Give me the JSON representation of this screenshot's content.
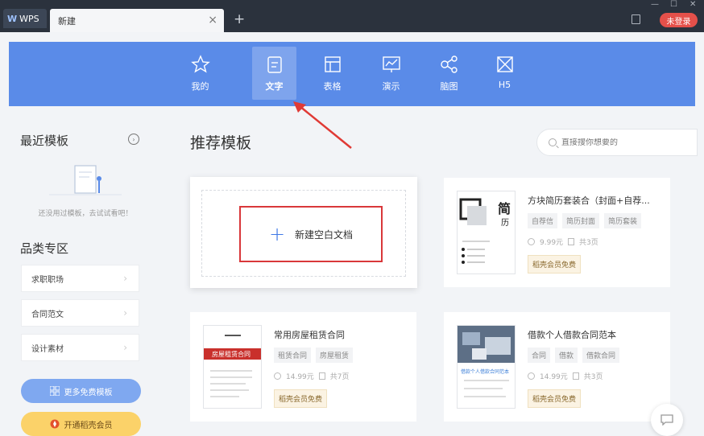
{
  "titlebar": {
    "logo": "WPS",
    "tab_label": "新建",
    "login_label": "未登录",
    "win_min": "—",
    "win_max": "☐",
    "win_close": "✕"
  },
  "nav": {
    "items": [
      {
        "label": "我的",
        "icon": "star-icon"
      },
      {
        "label": "文字",
        "icon": "document-icon"
      },
      {
        "label": "表格",
        "icon": "table-icon"
      },
      {
        "label": "演示",
        "icon": "presentation-icon"
      },
      {
        "label": "脑图",
        "icon": "mindmap-icon"
      },
      {
        "label": "H5",
        "icon": "h5-icon"
      }
    ],
    "active": "文字"
  },
  "sidebar": {
    "recent_title": "最近模板",
    "empty_text": "还没用过模板，去试试看吧！",
    "category_title": "品类专区",
    "categories": [
      "求职职场",
      "合同范文",
      "设计素材"
    ],
    "more_button": "更多免费模板",
    "vip_button": "开通稻壳会员"
  },
  "main": {
    "title": "推荐模板",
    "search_placeholder": "直接搜你想要的",
    "new_blank_label": "新建空白文档",
    "templates": [
      {
        "title": "方块简历套装合（封面+自荐...",
        "tags": [
          "自荐信",
          "简历封面",
          "简历套装"
        ],
        "price": "9.99元",
        "pages": "共3页",
        "badge": "稻壳会员免费",
        "thumb_text": [
          "简",
          "历"
        ]
      },
      {
        "title": "常用房屋租赁合同",
        "tags": [
          "租赁合同",
          "房屋租赁"
        ],
        "price": "14.99元",
        "pages": "共7页",
        "badge": "稻壳会员免费",
        "thumb_text": [
          "房屋租赁合同"
        ]
      },
      {
        "title": "借款个人借款合同范本",
        "tags": [
          "合同",
          "借款",
          "借款合同"
        ],
        "price": "14.99元",
        "pages": "共3页",
        "badge": "稻壳会员免费",
        "thumb_text": [
          "借款个人借款合同范本"
        ]
      }
    ]
  }
}
